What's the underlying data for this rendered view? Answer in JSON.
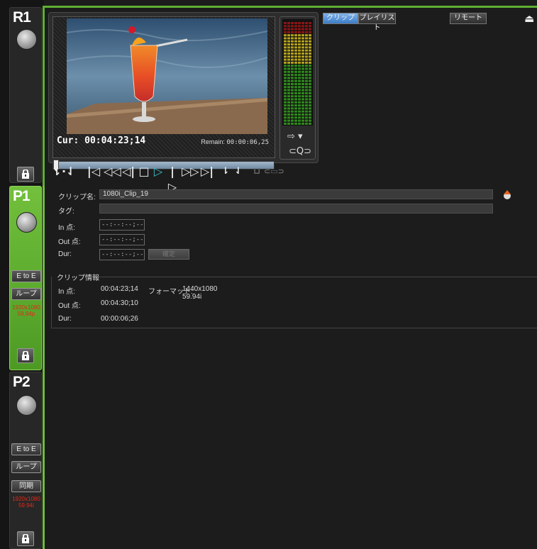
{
  "rail": {
    "r1": {
      "label": "R1"
    },
    "p1": {
      "label": "P1",
      "e_to_e": "E to E",
      "loop": "ループ",
      "format_line1": "1920x1080",
      "format_line2": "59.94p"
    },
    "p2": {
      "label": "P2",
      "e_to_e": "E to E",
      "loop": "ループ",
      "sync": "同期",
      "format_line1": "1920x1080",
      "format_line2": "59.94i"
    }
  },
  "player": {
    "cur_label": "Cur:",
    "cur_time": "00:04:23;14",
    "remain_label": "Remain:",
    "remain_time": "00:00:06,25",
    "scrub_position": 0.0
  },
  "tabs": {
    "clip": "クリップ",
    "playlist": "プレイリスト",
    "remote": "リモート"
  },
  "clip_form": {
    "clip_name_label": "クリップ名:",
    "clip_name_value": "1080i_Clip_19",
    "tag_label": "タグ:",
    "tag_value": "",
    "in_label": "In 点:",
    "in_value": "--:--:--;--",
    "out_label": "Out 点:",
    "out_value": "--:--:--;--",
    "dur_label": "Dur:",
    "dur_value": "--:--:--;--",
    "confirm_label": "確定"
  },
  "clip_info": {
    "heading": "クリップ情報",
    "in_label": "In 点:",
    "in_value": "00:04:23;14",
    "out_label": "Out 点:",
    "out_value": "00:04:30;10",
    "dur_label": "Dur:",
    "dur_value": "00:00:06;26",
    "format_label": "フォーマット:",
    "format_line1": "1440x1080",
    "format_line2": "59.94i"
  },
  "colors": {
    "accent_green": "#6fbc3a",
    "active_tab": "#5b96d8",
    "play": "#3ac0c8"
  }
}
